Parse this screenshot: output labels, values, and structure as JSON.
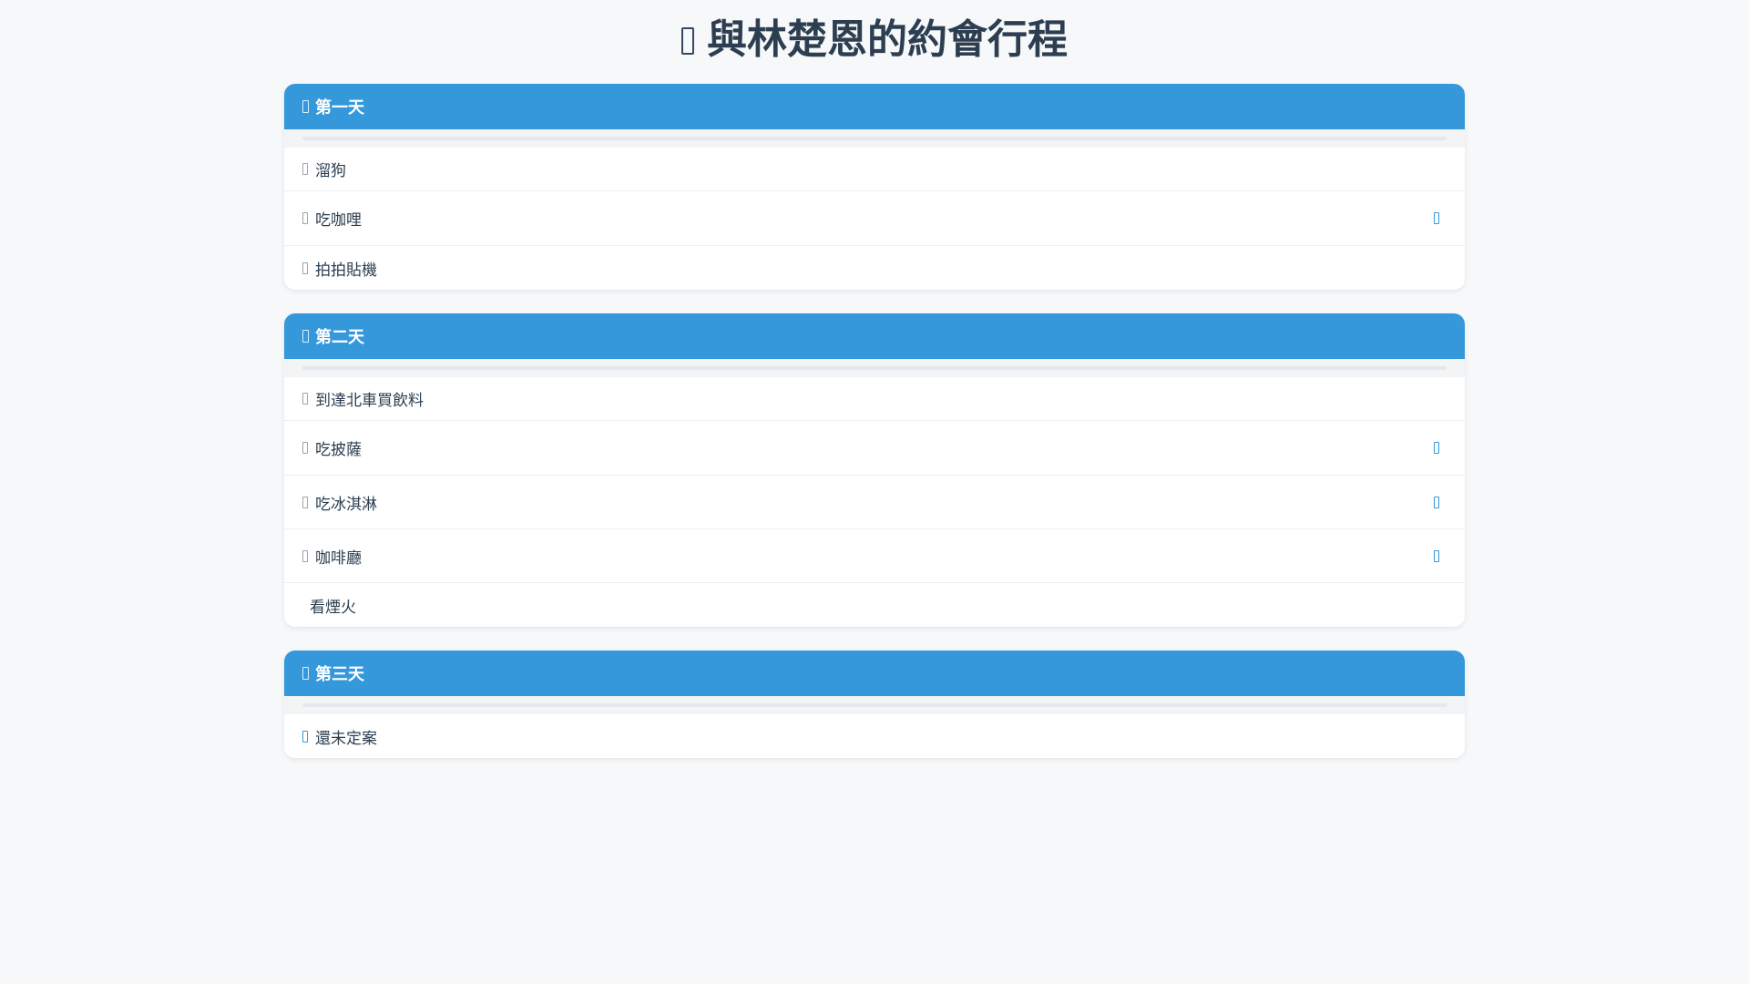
{
  "title": "與林楚恩的約會行程",
  "days": [
    {
      "label": "第一天",
      "items": [
        {
          "text": "溜狗",
          "has_action": false
        },
        {
          "text": "吃咖哩",
          "has_action": true
        },
        {
          "text": "拍拍貼機",
          "has_action": false
        }
      ]
    },
    {
      "label": "第二天",
      "items": [
        {
          "text": "到達北車買飲料",
          "has_action": false
        },
        {
          "text": "吃披薩",
          "has_action": true
        },
        {
          "text": "吃冰淇淋",
          "has_action": true
        },
        {
          "text": "咖啡廳",
          "has_action": true
        },
        {
          "text": "看煙火",
          "has_action": false
        }
      ]
    },
    {
      "label": "第三天",
      "items": [
        {
          "text": "還未定案",
          "has_action": false
        }
      ]
    }
  ],
  "colors": {
    "header": "#3498db",
    "background": "#f6f8fa",
    "title": "#2c3e50"
  }
}
